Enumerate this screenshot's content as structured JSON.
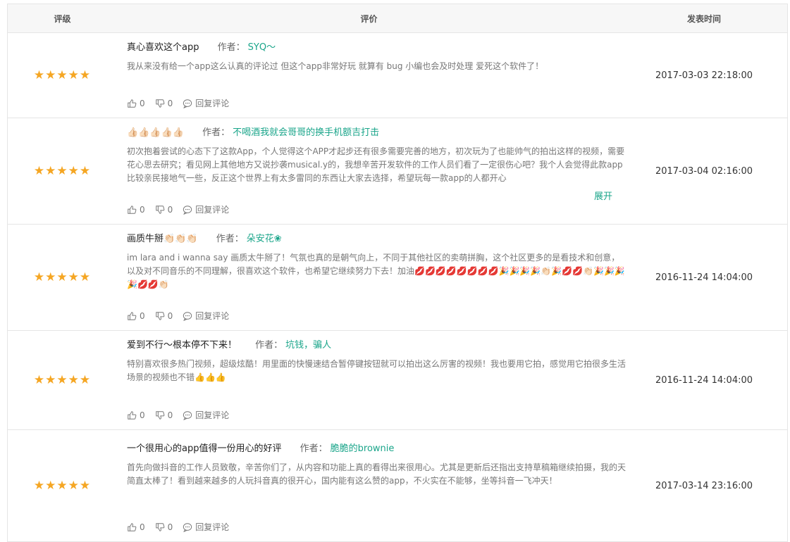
{
  "columns": {
    "rating": "评级",
    "review": "评价",
    "time": "发表时间"
  },
  "author_label": "作者：",
  "reply_label": "回复评论",
  "expand_label": "展开",
  "star_text": "★★★★★",
  "reviews": [
    {
      "title": "真心喜欢这个app",
      "author": "SYQ～",
      "content": "我从来没有给一个app这么认真的评论过 但这个app非常好玩 就算有 bug 小编也会及时处理 爱死这个软件了！",
      "time": "2017-03-03 22:18:00",
      "likes": "0",
      "dislikes": "0"
    },
    {
      "title": "👍🏻👍🏻👍🏻👍🏻👍🏻",
      "author": "不喝酒我就会哥哥的换手机额吉打击",
      "content": "初次抱着尝试的心态下了这款App，个人觉得这个APP才起步还有很多需要完善的地方，初次玩为了也能帅气的拍出这样的视频，需要花心思去研究；看见网上其他地方又说抄袭musical.y的，我想辛苦开发软件的工作人员们看了一定很伤心吧？我个人会觉得此款app比较亲民接地气一些，反正这个世界上有太多雷同的东西让大家去选择，希望玩每一款app的人都开心",
      "time": "2017-03-04 02:16:00",
      "likes": "0",
      "dislikes": "0"
    },
    {
      "title": "画质牛掰👏🏻👏🏻👏🏻",
      "author": "朵安花❀",
      "content": "im lara and i wanna say 画质太牛掰了！气氛也真的是朝气向上，不同于其他社区的卖萌拼胸，这个社区更多的是看技术和创意，以及对不同音乐的不同理解，很喜欢这个软件，也希望它继续努力下去！加油💋💋💋💋💋💋💋💋🎉🎉🎉🎉👏🏻🎉💋💋👏🏻🎉🎉🎉🎉💋💋👏🏻",
      "time": "2016-11-24 14:04:00",
      "likes": "0",
      "dislikes": "0"
    },
    {
      "title": "爱到不行～根本停不下来！",
      "author": "坑钱，骗人",
      "content": "特别喜欢很多热门视频，超级炫酷！用里面的快慢速结合暂停键按钮就可以拍出这么厉害的视频！我也要用它拍，感觉用它拍很多生活场景的视频也不错👍👍👍",
      "time": "2016-11-24 14:04:00",
      "likes": "0",
      "dislikes": "0"
    },
    {
      "title": "一个很用心的app值得一份用心的好评",
      "author": "脆脆的brownie",
      "content": "首先向做抖音的工作人员致敬，辛苦你们了，从内容和功能上真的看得出来很用心。尤其是更新后还指出支持草稿箱继续拍摄，我的天简直太棒了！看到越来越多的人玩抖音真的很开心，国内能有这么赞的app，不火实在不能够，坐等抖音一飞冲天！",
      "time": "2017-03-14 23:16:00",
      "likes": "0",
      "dislikes": "0"
    }
  ]
}
